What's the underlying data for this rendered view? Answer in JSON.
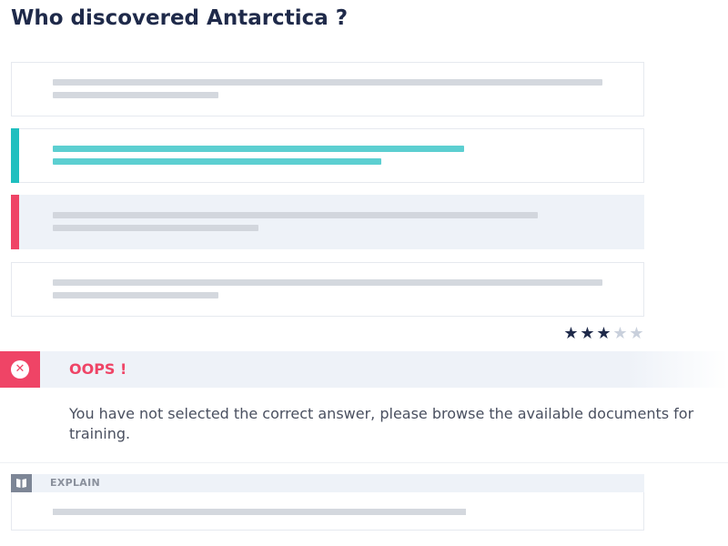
{
  "question": {
    "title": "Who discovered Antarctica ?"
  },
  "options": [
    {
      "state": "neutral"
    },
    {
      "state": "correct-answer"
    },
    {
      "state": "selected-wrong"
    },
    {
      "state": "neutral"
    }
  ],
  "rating": {
    "filled": 3,
    "max": 5,
    "filled_glyph": "★",
    "empty_glyph": "★"
  },
  "feedback": {
    "icon": "close-circle-icon",
    "icon_glyph": "✕",
    "title": "OOPS !",
    "message": "You have not selected the correct answer, please browse the available documents for training."
  },
  "explain": {
    "icon": "book-icon",
    "label": "EXPLAIN"
  },
  "colors": {
    "title": "#1f2a4a",
    "correct": "#1fbfbf",
    "correct_bars": "#5ccfd1",
    "wrong": "#ef4466",
    "highlight_bg": "#eef2f8",
    "placeholder_bars": "#d4d8de"
  }
}
